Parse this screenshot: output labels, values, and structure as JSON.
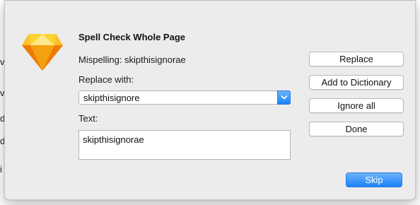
{
  "background_glyphs": [
    "v",
    "v",
    "d",
    "d",
    "i"
  ],
  "dialog": {
    "title": "Spell Check Whole Page",
    "mispelling_text": "Mispelling: skipthisignorae",
    "replace_with_label": "Replace with:",
    "replace_with_value": "skipthisignore",
    "text_label": "Text:",
    "text_value": "skipthisignorae",
    "buttons": {
      "replace": "Replace",
      "add_to_dictionary": "Add to Dictionary",
      "ignore_all": "Ignore all",
      "done": "Done",
      "skip": "Skip"
    },
    "app_icon": "sketch-diamond-icon"
  },
  "colors": {
    "accent": "#1a82fb",
    "dialog_bg": "#ececec"
  }
}
